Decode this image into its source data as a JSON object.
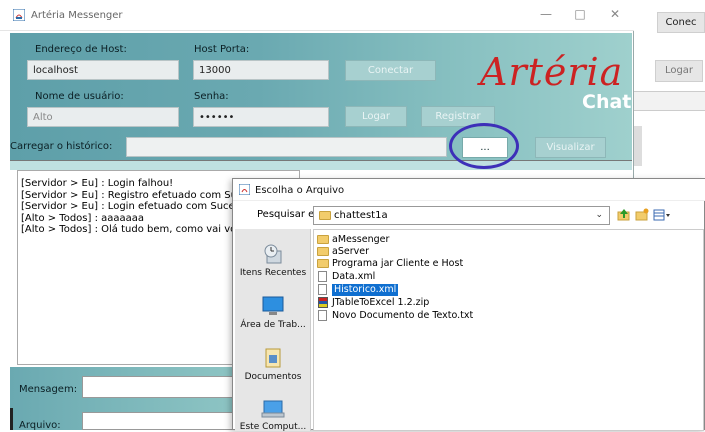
{
  "main_window": {
    "title": "Artéria Messenger",
    "host_label": "Endereço de Host:",
    "host_value": "localhost",
    "port_label": "Host Porta:",
    "port_value": "13000",
    "connect_label": "Conectar",
    "user_label": "Nome de usuário:",
    "user_value": "Alto",
    "password_label": "Senha:",
    "password_value": "••••••",
    "login_label": "Logar",
    "register_label": "Registrar",
    "history_label": "Carregar o histórico:",
    "browse_label": "...",
    "view_label": "Visualizar",
    "logo_main": "Artéria",
    "logo_sub": "Chat",
    "chat_lines": [
      "[Servidor > Eu] : Login falhou!",
      "[Servidor > Eu] : Registro efetuado com Suces",
      "[Servidor > Eu] : Login efetuado com Sucesso",
      "[Alto > Todos] : aaaaaaa",
      "[Alto > Todos] : Olá tudo bem, como vai voce"
    ],
    "message_label": "Mensagem:",
    "file_label": "Arquivo:"
  },
  "background_window": {
    "connect_label": "Conec",
    "login_label": "Logar"
  },
  "dialog": {
    "title": "Escolha o Arquivo",
    "look_in_label": "Pesquisar em:",
    "look_in_value": "chattest1a",
    "places": [
      {
        "label": "Itens Recentes",
        "icon": "recent-items-icon"
      },
      {
        "label": "Área de Trab...",
        "icon": "desktop-icon"
      },
      {
        "label": "Documentos",
        "icon": "documents-icon"
      },
      {
        "label": "Este Comput...",
        "icon": "computer-icon"
      }
    ],
    "files": [
      {
        "name": "aMessenger",
        "kind": "folder"
      },
      {
        "name": "aServer",
        "kind": "folder"
      },
      {
        "name": "Programa jar Cliente e Host",
        "kind": "folder"
      },
      {
        "name": "Data.xml",
        "kind": "file"
      },
      {
        "name": "Historico.xml",
        "kind": "file",
        "selected": true
      },
      {
        "name": "JTableToExcel 1.2.zip",
        "kind": "zip"
      },
      {
        "name": "Novo Documento de Texto.txt",
        "kind": "file"
      }
    ]
  },
  "colors": {
    "accent_selection": "#0f6fd0",
    "logo_red": "#cc2222",
    "highlight_ring": "#3d2fb8"
  }
}
